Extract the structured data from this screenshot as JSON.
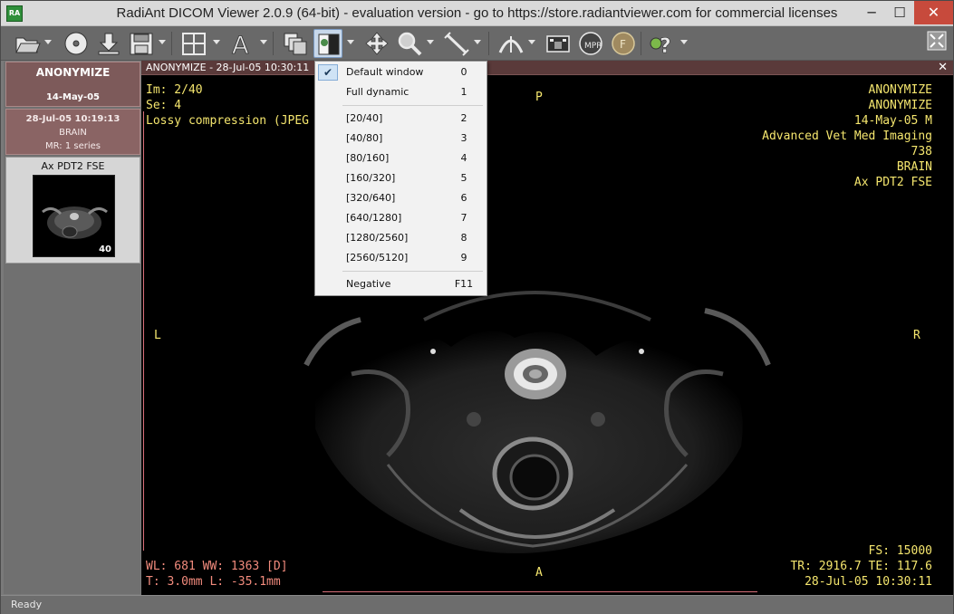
{
  "window": {
    "title": "RadiAnt DICOM Viewer 2.0.9 (64-bit) - evaluation version - go to https://store.radiantviewer.com for commercial licenses",
    "app_icon": "RA",
    "min_glyph": "─",
    "max_glyph": "☐",
    "close_glyph": "✕"
  },
  "toolbar": {
    "icons": [
      "open-folder-icon",
      "cd-dvd-icon",
      "download-icon",
      "save-icon",
      "layout-grid-icon",
      "annotation-text-icon",
      "series-stack-icon",
      "window-level-icon",
      "pan-icon",
      "zoom-icon",
      "measure-icon",
      "3d-mpr-icon",
      "video-export-icon",
      "mpr-icon",
      "fusion-icon",
      "help-icon",
      "fullscreen-icon"
    ],
    "cd_label": "CD DVD",
    "text_tool_label": "A",
    "mpr_label": "MPR",
    "fusion_label": "F"
  },
  "study": {
    "patient": "ANONYMIZE",
    "date": "14-May-05",
    "series_datetime": "28-Jul-05 10:19:13",
    "body_part": "BRAIN",
    "series_info": "MR: 1 series",
    "thumb_label": "Ax PDT2 FSE",
    "thumb_count": "40"
  },
  "viewer": {
    "title": "ANONYMIZE - 28-Jul-05 10:30:11",
    "close_glyph": "✕",
    "overlay_top_left": [
      "Im: 2/40",
      "Se: 4",
      "Lossy compression (JPEG"
    ],
    "overlay_top_right": [
      "ANONYMIZE",
      "ANONYMIZE",
      "14-May-05 M",
      "Advanced Vet Med Imaging",
      "738",
      "BRAIN",
      "Ax PDT2 FSE"
    ],
    "overlay_bottom_left": [
      "WL: 681 WW: 1363 [D]",
      "T: 3.0mm L: -35.1mm"
    ],
    "overlay_bottom_right": [
      "FS: 15000",
      "TR: 2916.7 TE: 117.6",
      "28-Jul-05 10:30:11"
    ],
    "orient_top": "P",
    "orient_bottom": "A",
    "orient_left": "L",
    "orient_right": "R"
  },
  "wl_menu": {
    "check_glyph": "✔",
    "items": [
      {
        "label": "Default window",
        "key": "0"
      },
      {
        "label": "Full dynamic",
        "key": "1"
      },
      {
        "label": "[20/40]",
        "key": "2"
      },
      {
        "label": "[40/80]",
        "key": "3"
      },
      {
        "label": "[80/160]",
        "key": "4"
      },
      {
        "label": "[160/320]",
        "key": "5"
      },
      {
        "label": "[320/640]",
        "key": "6"
      },
      {
        "label": "[640/1280]",
        "key": "7"
      },
      {
        "label": "[1280/2560]",
        "key": "8"
      },
      {
        "label": "[2560/5120]",
        "key": "9"
      },
      {
        "label": "Negative",
        "key": "F11"
      }
    ]
  },
  "status": {
    "text": "Ready"
  }
}
